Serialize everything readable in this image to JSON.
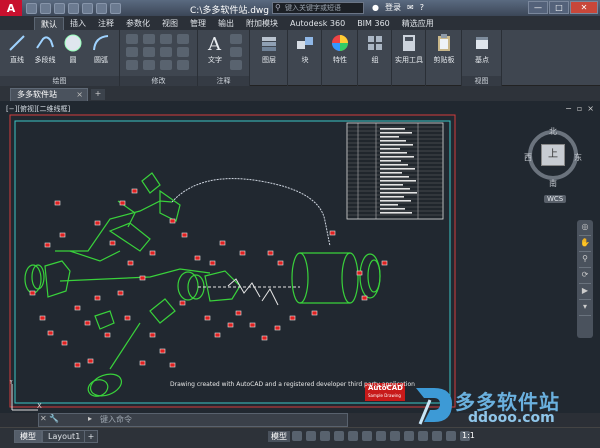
{
  "title_bar": {
    "document_title": "C:\\多多软件站.dwg",
    "search_placeholder": "键入关键字或短语",
    "login": "登录",
    "window_buttons": [
      "—",
      "□",
      "✕"
    ]
  },
  "ribbon_tabs": [
    "默认",
    "插入",
    "注释",
    "参数化",
    "视图",
    "管理",
    "输出",
    "附加模块",
    "Autodesk 360",
    "BIM 360",
    "精选应用"
  ],
  "active_tab": "默认",
  "ribbon": {
    "draw_tools": [
      "直线",
      "多段线",
      "圆",
      "圆弧"
    ],
    "draw_panel": "绘图",
    "modify_panel": "修改",
    "text_tool": "文字",
    "annotation_panel": "注释",
    "layers": "图层",
    "block": "块",
    "properties": "特性",
    "group": "组",
    "utilities": "实用工具",
    "clipboard": "剪贴板",
    "base": "基点",
    "view_panel": "视图"
  },
  "file_tab": {
    "name": "多多软件站"
  },
  "viewport": {
    "label": "[−][俯视][二维线框]",
    "viewcube": {
      "north": "北",
      "south": "南",
      "west": "西",
      "east": "东",
      "face": "上",
      "wcs": "WCS"
    }
  },
  "drawing": {
    "caption": "Drawing created with AutoCAD and a registered developer third party application",
    "logo": "AutoCAD",
    "logo_sub": "Sample Drawing"
  },
  "command_line": {
    "placeholder": "键入命令"
  },
  "layout_tabs": [
    "模型",
    "Layout1"
  ],
  "status_bar": {
    "model": "模型",
    "scale": "1:1"
  },
  "watermark": {
    "text": "多多软件站",
    "url": "ddooo.com"
  },
  "colors": {
    "accent_red": "#c8102e",
    "drawing_green": "#39d23b",
    "marker_red": "#e02020",
    "frame_red": "#d23c3c",
    "frame_cyan": "#3ac6c6"
  }
}
